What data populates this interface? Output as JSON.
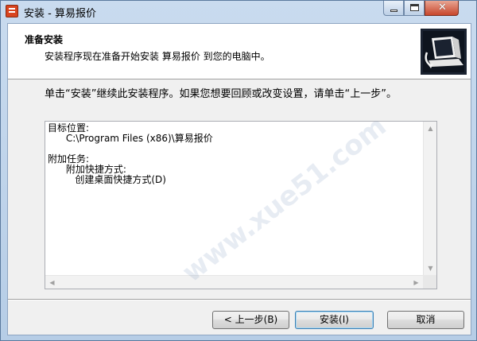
{
  "window": {
    "title": "安装 - 算易报价",
    "controls": {
      "minimize_icon": "minimize-icon",
      "maximize_icon": "maximize-icon",
      "close_icon": "close-icon",
      "close_glyph": "✕"
    }
  },
  "header": {
    "title": "准备安装",
    "subtitle": "安装程序现在准备开始安装 算易报价 到您的电脑中。",
    "logo_icon": "computer-install-icon"
  },
  "instruction": "单击“安装”继续此安装程序。如果您想要回顾或改变设置，请单击“上一步”。",
  "memo": {
    "lines": [
      "目标位置:",
      "      C:\\Program Files (x86)\\算易报价",
      "",
      "附加任务:",
      "      附加快捷方式:",
      "         创建桌面快捷方式(D)"
    ]
  },
  "buttons": {
    "back": "< 上一步(B)",
    "install": "安装(I)",
    "cancel": "取消"
  },
  "watermark": "www.xue51.com",
  "colors": {
    "accent": "#3c7fb1",
    "close_button": "#c7462c"
  }
}
